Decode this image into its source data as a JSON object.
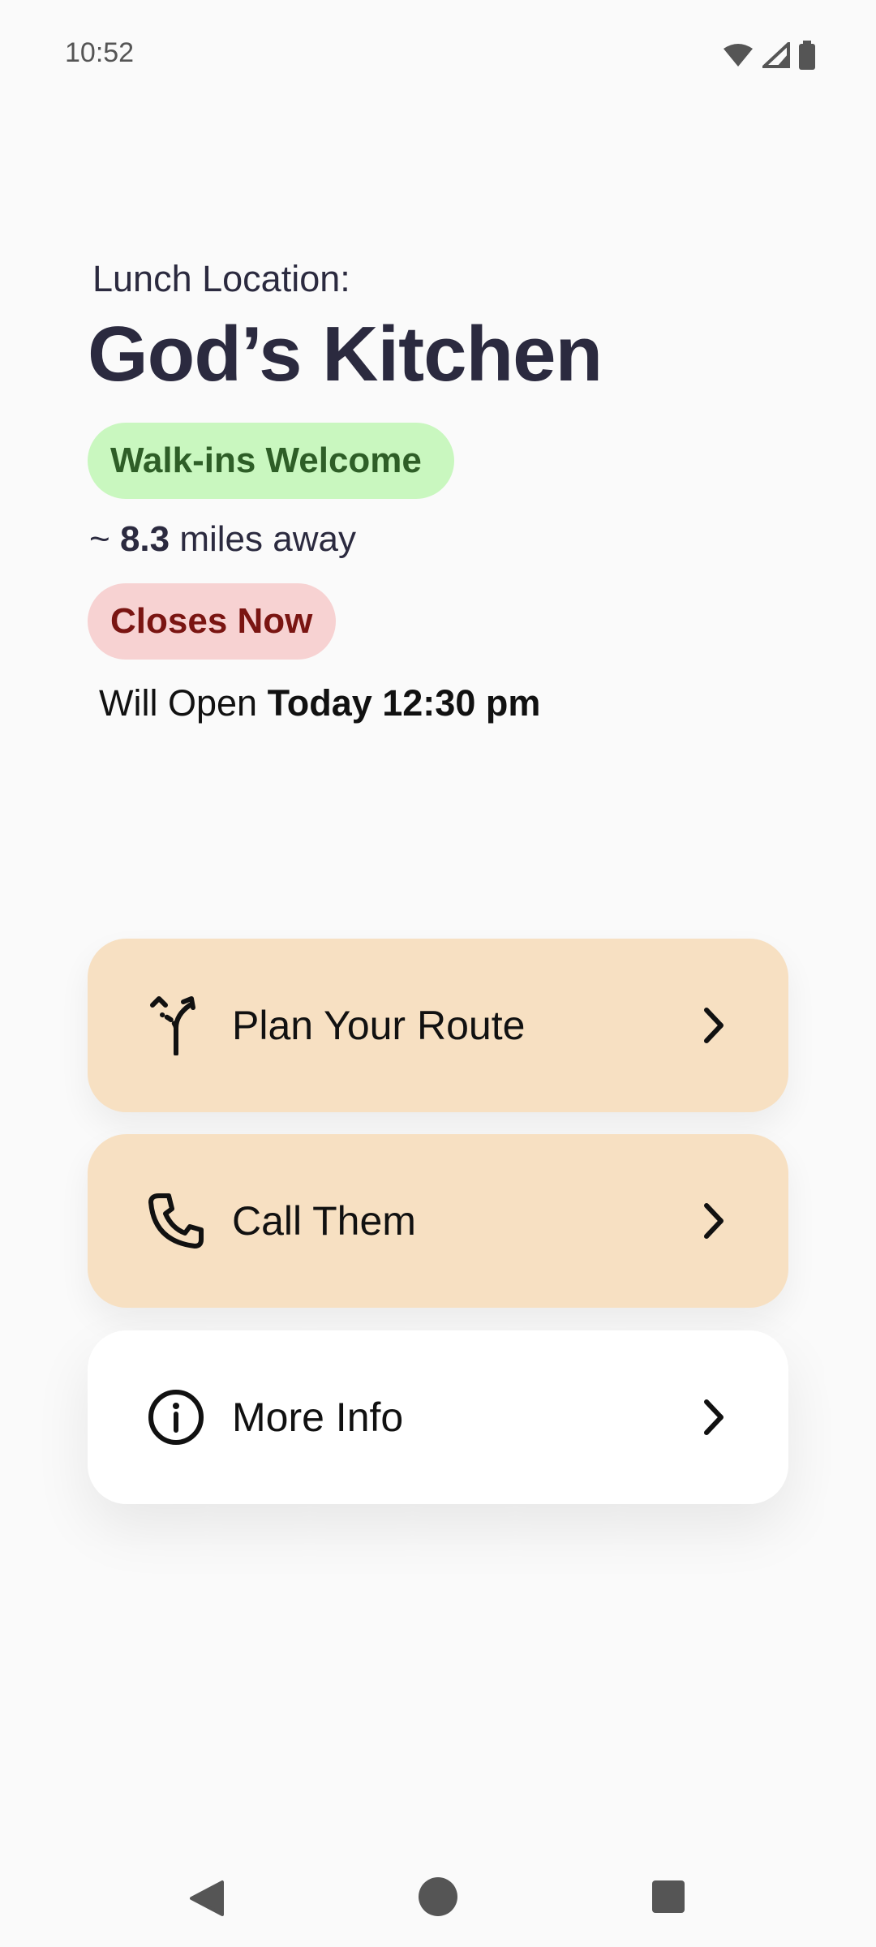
{
  "status_bar": {
    "time": "10:52",
    "icons": [
      "wifi-icon",
      "signal-icon",
      "battery-icon"
    ]
  },
  "header": {
    "label": "Lunch Location:",
    "title": "God’s Kitchen"
  },
  "badges": {
    "walkins": "Walk-ins Welcome",
    "closes": "Closes Now"
  },
  "distance": {
    "prefix": "~",
    "value": "8.3",
    "suffix": "miles away"
  },
  "opening": {
    "prefix": "Will Open",
    "time": "Today 12:30 pm"
  },
  "actions": [
    {
      "label": "Plan Your Route",
      "icon": "route-fork-icon"
    },
    {
      "label": "Call Them",
      "icon": "phone-icon"
    },
    {
      "label": "More Info",
      "icon": "info-icon"
    }
  ],
  "colors": {
    "action_primary_bg": "#f7e0c2",
    "walkins_bg": "#c9f7bf",
    "walkins_text": "#2e5e27",
    "closes_bg": "#f7d2d2",
    "closes_text": "#7a1512"
  },
  "nav_bar": {
    "buttons": [
      "back-icon",
      "home-icon",
      "recents-icon"
    ]
  }
}
